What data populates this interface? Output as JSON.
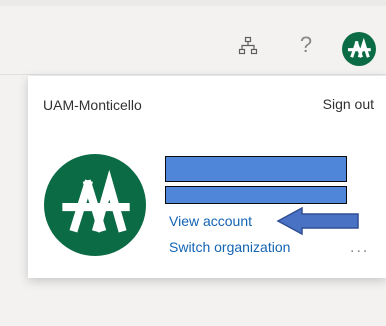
{
  "header": {
    "org_icon": "org-chart-icon",
    "help_label": "?",
    "avatar_icon": "uam-logo-icon"
  },
  "account_panel": {
    "org_name": "UAM-Monticello",
    "sign_out_label": "Sign out",
    "view_account_label": "View account",
    "switch_org_label": "Switch organization",
    "more_label": "...",
    "redaction_color": "#4f86d9",
    "arrow_color": "#4a72c4"
  },
  "colors": {
    "brand_green": "#0b6b45",
    "link_blue": "#1464b4"
  }
}
